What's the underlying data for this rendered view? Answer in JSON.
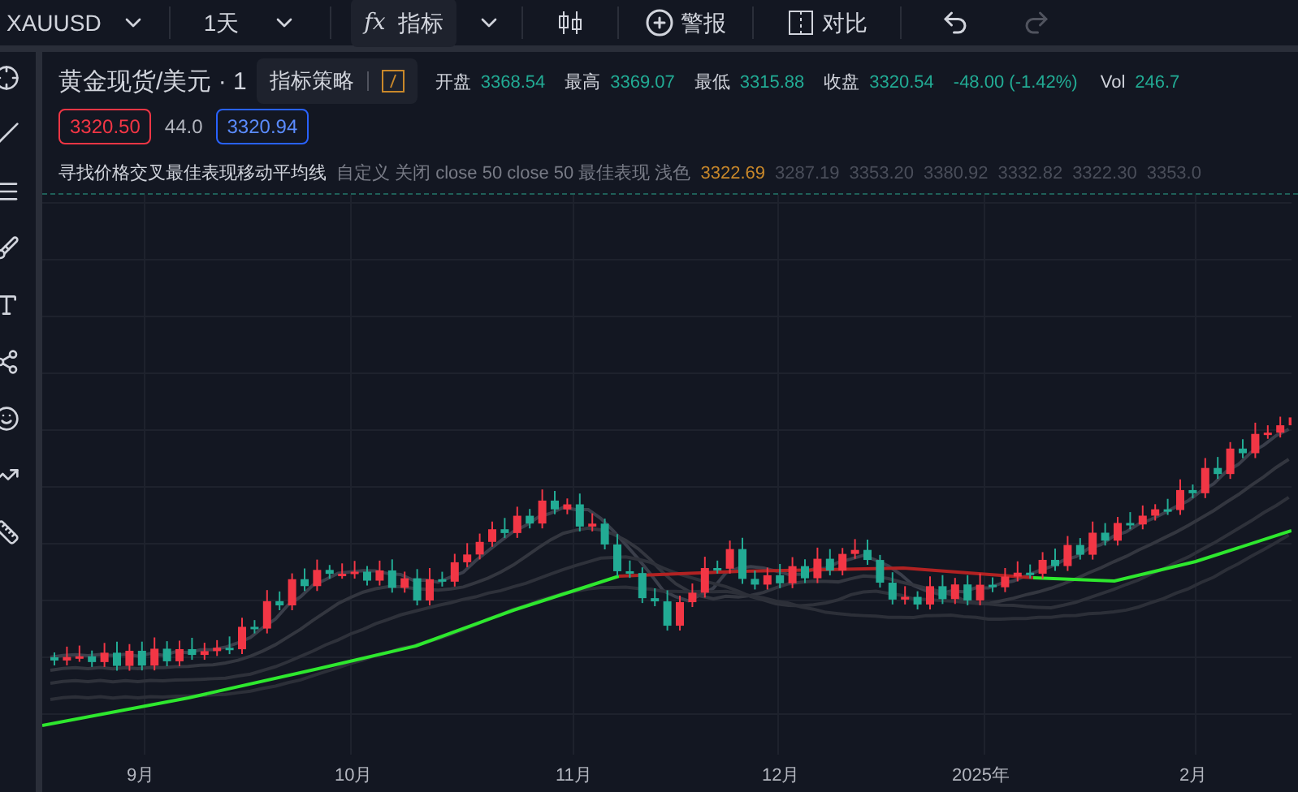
{
  "toolbar": {
    "symbol": "XAUUSD",
    "interval": "1天",
    "indicators_icon": "fx",
    "indicators": "指标",
    "alert": "警报",
    "compare": "对比",
    "redo_disabled": true
  },
  "tooltip": {
    "text": "指标策略"
  },
  "legend": {
    "title": "黄金现货/美元 · 1",
    "ohlc": [
      {
        "label": "开盘",
        "value": "3368.54"
      },
      {
        "label": "最高",
        "value": "3369.07"
      },
      {
        "label": "最低",
        "value": "3315.88"
      },
      {
        "label": "收盘",
        "value": "3320.54"
      }
    ],
    "change": "-48.00 (-1.42%)",
    "volume_label": "Vol",
    "volume_value": "246.7",
    "sell_price": "3320.50",
    "spread": "44.0",
    "buy_price": "3320.94"
  },
  "indicator": {
    "name": "寻找价格交叉最佳表现移动平均线",
    "params": "自定义 关闭 close 50 close 50 最佳表现 浅色",
    "values": [
      {
        "text": "3322.69",
        "color": "#c9882a"
      },
      {
        "text": "3287.19",
        "color": "#4a4e5a"
      },
      {
        "text": "3353.20",
        "color": "#4a4e5a"
      },
      {
        "text": "3380.92",
        "color": "#4a4e5a"
      },
      {
        "text": "3332.82",
        "color": "#4a4e5a"
      },
      {
        "text": "3322.30",
        "color": "#4a4e5a"
      },
      {
        "text": "3353.0",
        "color": "#4a4e5a"
      }
    ]
  },
  "x_axis": [
    "9月",
    "10月",
    "11月",
    "12月",
    "2025年",
    "2月"
  ]
}
